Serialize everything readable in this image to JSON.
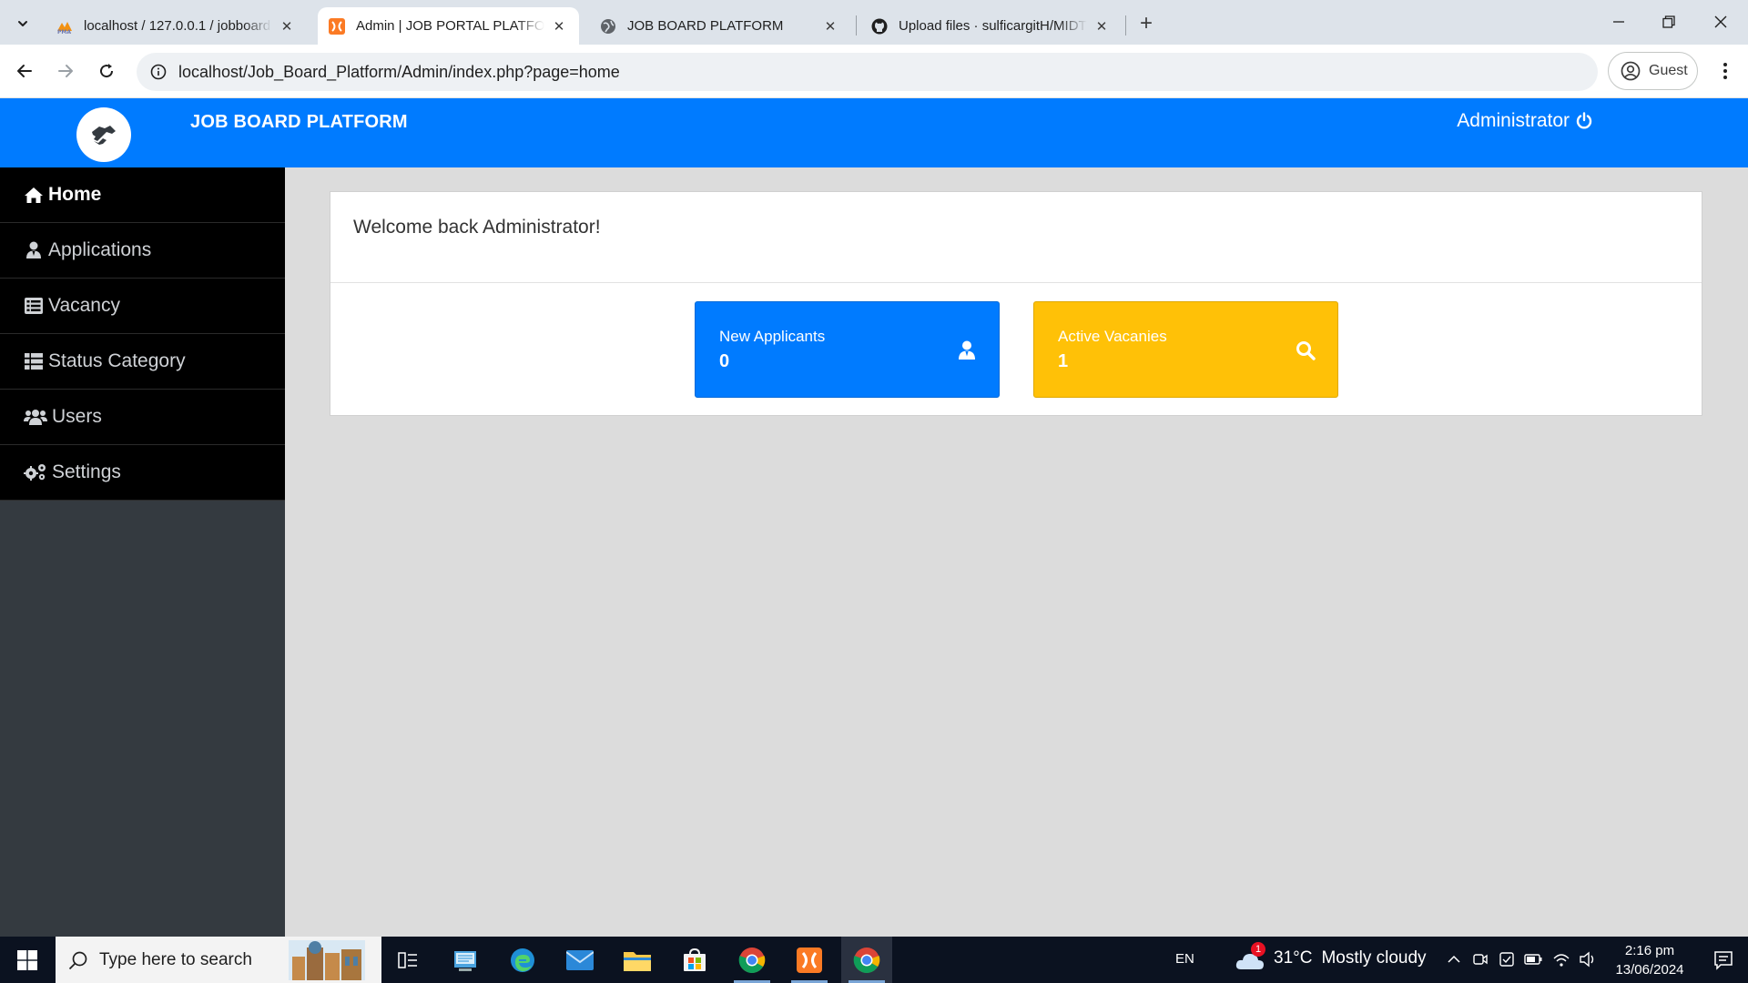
{
  "browser": {
    "tabs": [
      {
        "title": "localhost / 127.0.0.1 / jobboard",
        "favicon": "phpmyadmin-icon"
      },
      {
        "title": "Admin | JOB PORTAL PLATFORM",
        "favicon": "xampp-icon"
      },
      {
        "title": "JOB BOARD PLATFORM",
        "favicon": "globe-icon"
      },
      {
        "title": "Upload files · sulficargitH/MIDTERM",
        "favicon": "github-icon"
      }
    ],
    "active_tab": 1,
    "url": "localhost/Job_Board_Platform/Admin/index.php?page=home",
    "profile_label": "Guest"
  },
  "header": {
    "brand": "JOB BOARD PLATFORM",
    "user": "Administrator",
    "color": "#007bff"
  },
  "sidebar": {
    "items": [
      {
        "label": "Home",
        "icon": "home-icon",
        "active": true
      },
      {
        "label": "Applications",
        "icon": "user-icon"
      },
      {
        "label": "Vacancy",
        "icon": "list-icon"
      },
      {
        "label": "Status Category",
        "icon": "table-icon"
      },
      {
        "label": "Users",
        "icon": "users-icon"
      },
      {
        "label": "Settings",
        "icon": "gears-icon"
      }
    ]
  },
  "main": {
    "welcome": "Welcome back Administrator!",
    "stats": [
      {
        "label": "New Applicants",
        "value": "0",
        "icon": "user-icon",
        "color": "#007bff"
      },
      {
        "label": "Active Vacanies",
        "value": "1",
        "icon": "search-icon",
        "color": "#ffc107"
      }
    ]
  },
  "taskbar": {
    "search_placeholder": "Type here to search",
    "language": "EN",
    "weather": {
      "temp": "31°C",
      "condition": "Mostly cloudy",
      "badge": "1"
    },
    "time": "2:16 pm",
    "date": "13/06/2024"
  }
}
